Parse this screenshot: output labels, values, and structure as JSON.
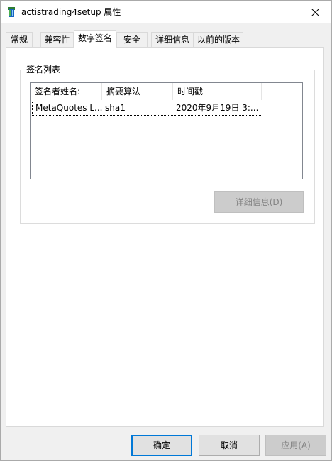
{
  "window": {
    "title": "actistrading4setup 属性"
  },
  "tabs": [
    {
      "label": "常规"
    },
    {
      "label": "兼容性"
    },
    {
      "label": "数字签名",
      "selected": true
    },
    {
      "label": "安全"
    },
    {
      "label": "详细信息"
    },
    {
      "label": "以前的版本"
    }
  ],
  "signature_group": {
    "label": "签名列表",
    "columns": [
      "签名者姓名:",
      "摘要算法",
      "时间戳"
    ],
    "rows": [
      {
        "signer": "MetaQuotes L...",
        "digest": "sha1",
        "timestamp": "2020年9月19日 3:..."
      }
    ],
    "details_button": "详细信息(D)"
  },
  "footer": {
    "ok_label": "确定",
    "cancel_label": "取消",
    "apply_label": "应用(A)"
  },
  "icons": {
    "app": "installer-icon",
    "close": "close-icon"
  },
  "colors": {
    "focus_border": "#0078d7",
    "disabled_text": "#838383"
  }
}
